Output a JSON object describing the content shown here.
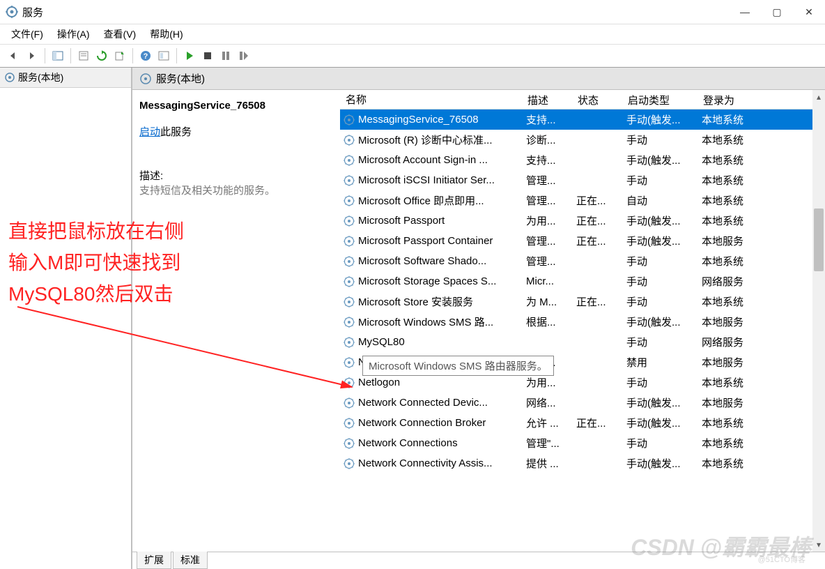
{
  "window": {
    "title": "服务",
    "min": "—",
    "max": "▢",
    "close": "✕"
  },
  "menu": {
    "file": "文件(F)",
    "action": "操作(A)",
    "view": "查看(V)",
    "help": "帮助(H)"
  },
  "left_pane": {
    "label": "服务(本地)"
  },
  "right_header": {
    "label": "服务(本地)"
  },
  "detail": {
    "service_name": "MessagingService_76508",
    "start_word": "启动",
    "start_suffix": "此服务",
    "desc_label": "描述:",
    "desc_text": "支持短信及相关功能的服务。"
  },
  "columns": {
    "name": "名称",
    "desc": "描述",
    "status": "状态",
    "startup": "启动类型",
    "logon": "登录为"
  },
  "services": [
    {
      "name": "MessagingService_76508",
      "desc": "支持...",
      "status": "",
      "startup": "手动(触发...",
      "logon": "本地系统",
      "selected": true
    },
    {
      "name": "Microsoft (R) 诊断中心标准...",
      "desc": "诊断...",
      "status": "",
      "startup": "手动",
      "logon": "本地系统"
    },
    {
      "name": "Microsoft Account Sign-in ...",
      "desc": "支持...",
      "status": "",
      "startup": "手动(触发...",
      "logon": "本地系统"
    },
    {
      "name": "Microsoft iSCSI Initiator Ser...",
      "desc": "管理...",
      "status": "",
      "startup": "手动",
      "logon": "本地系统"
    },
    {
      "name": "Microsoft Office 即点即用...",
      "desc": "管理...",
      "status": "正在...",
      "startup": "自动",
      "logon": "本地系统"
    },
    {
      "name": "Microsoft Passport",
      "desc": "为用...",
      "status": "正在...",
      "startup": "手动(触发...",
      "logon": "本地系统"
    },
    {
      "name": "Microsoft Passport Container",
      "desc": "管理...",
      "status": "正在...",
      "startup": "手动(触发...",
      "logon": "本地服务"
    },
    {
      "name": "Microsoft Software Shado...",
      "desc": "管理...",
      "status": "",
      "startup": "手动",
      "logon": "本地系统"
    },
    {
      "name": "Microsoft Storage Spaces S...",
      "desc": "Micr...",
      "status": "",
      "startup": "手动",
      "logon": "网络服务"
    },
    {
      "name": "Microsoft Store 安装服务",
      "desc": "为 M...",
      "status": "正在...",
      "startup": "手动",
      "logon": "本地系统"
    },
    {
      "name": "Microsoft Windows SMS 路...",
      "desc": "根据...",
      "status": "",
      "startup": "手动(触发...",
      "logon": "本地服务"
    },
    {
      "name": "MySQL80",
      "desc": "",
      "status": "",
      "startup": "手动",
      "logon": "网络服务"
    },
    {
      "name": "Net.Tcp Port Sharing Service",
      "desc": "提供...",
      "status": "",
      "startup": "禁用",
      "logon": "本地服务"
    },
    {
      "name": "Netlogon",
      "desc": "为用...",
      "status": "",
      "startup": "手动",
      "logon": "本地系统"
    },
    {
      "name": "Network Connected Devic...",
      "desc": "网络...",
      "status": "",
      "startup": "手动(触发...",
      "logon": "本地服务"
    },
    {
      "name": "Network Connection Broker",
      "desc": "允许 ...",
      "status": "正在...",
      "startup": "手动(触发...",
      "logon": "本地系统"
    },
    {
      "name": "Network Connections",
      "desc": "管理\"...",
      "status": "",
      "startup": "手动",
      "logon": "本地系统"
    },
    {
      "name": "Network Connectivity Assis...",
      "desc": "提供 ...",
      "status": "",
      "startup": "手动(触发...",
      "logon": "本地系统"
    }
  ],
  "tabs": {
    "extended": "扩展",
    "standard": "标准"
  },
  "tooltip": "Microsoft Windows SMS 路由器服务。",
  "annotation": {
    "line1": "直接把鼠标放在右侧",
    "line2": "输入M即可快速找到",
    "line3": "MySQL80然后双击"
  },
  "watermark": "CSDN @霸霸最棒",
  "watermark2": "@51CTO博客"
}
